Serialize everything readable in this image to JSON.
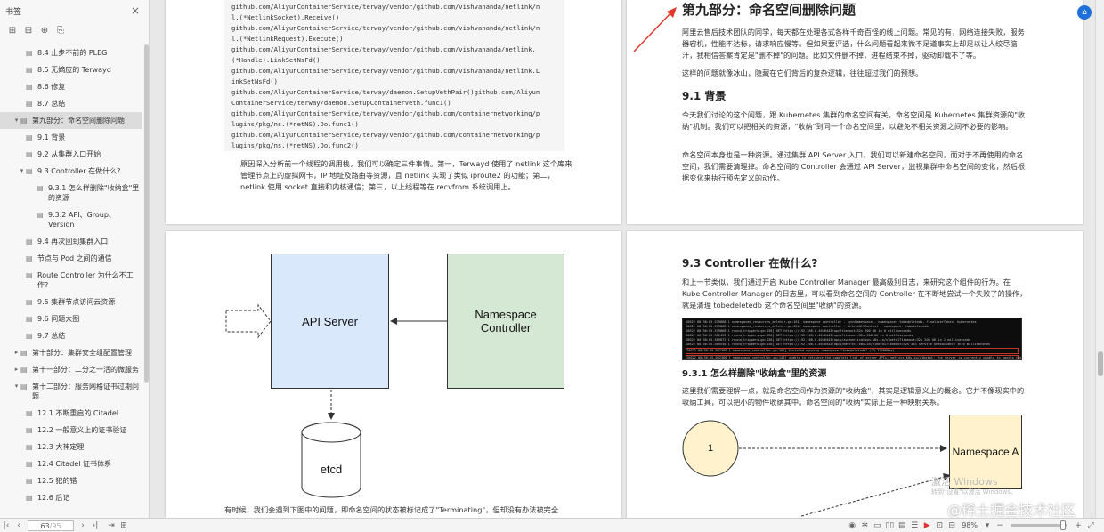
{
  "sidebar": {
    "title": "书签",
    "close_icon": "×",
    "tools": [
      "expand-all-icon",
      "collapse-all-icon",
      "bookmark-add-icon",
      "bookmark-icon"
    ],
    "items": [
      {
        "label": "8.4 止步不前的 PLEG",
        "level": 2,
        "type": "doc",
        "active": false
      },
      {
        "label": "8.5 无嫡应的 Terwayd",
        "level": 2,
        "type": "doc",
        "active": false
      },
      {
        "label": "8.6 修复",
        "level": 2,
        "type": "doc",
        "active": false
      },
      {
        "label": "8.7 总结",
        "level": 2,
        "type": "doc",
        "active": false
      },
      {
        "label": "第九部分：命名空间删除问题",
        "level": 1,
        "type": "expanded",
        "active": true
      },
      {
        "label": "9.1 背景",
        "level": 2,
        "type": "doc",
        "active": false
      },
      {
        "label": "9.2 从集群入口开始",
        "level": 2,
        "type": "doc",
        "active": false
      },
      {
        "label": "9.3 Controller 在做什么?",
        "level": 2,
        "type": "expanded",
        "active": false
      },
      {
        "label": "9.3.1 怎么样删除\"收纳盒\"里的资源",
        "level": 3,
        "type": "doc",
        "active": false
      },
      {
        "label": "9.3.2 API、Group、Version",
        "level": 3,
        "type": "doc",
        "active": false
      },
      {
        "label": "9.4 再次回到集群入口",
        "level": 2,
        "type": "doc",
        "active": false
      },
      {
        "label": "节点与 Pod 之间的通信",
        "level": 2,
        "type": "doc",
        "active": false
      },
      {
        "label": "Route Controller 为什么不工作?",
        "level": 2,
        "type": "doc",
        "active": false
      },
      {
        "label": "9.5 集群节点访问云资源",
        "level": 2,
        "type": "doc",
        "active": false
      },
      {
        "label": "9.6 问题大图",
        "level": 2,
        "type": "doc",
        "active": false
      },
      {
        "label": "9.7 总结",
        "level": 2,
        "type": "doc",
        "active": false
      },
      {
        "label": "第十部分：集群安全组配置管理",
        "level": 1,
        "type": "collapsed",
        "active": false
      },
      {
        "label": "第十一部分：二分之一活的微服务",
        "level": 1,
        "type": "collapsed",
        "active": false
      },
      {
        "label": "第十二部分：服务网格证书过期问题",
        "level": 1,
        "type": "expanded",
        "active": false
      },
      {
        "label": "12.1 不断重启的 Citadel",
        "level": 2,
        "type": "doc",
        "active": false
      },
      {
        "label": "12.2 一般意义上的证书验证",
        "level": 2,
        "type": "doc",
        "active": false
      },
      {
        "label": "12.3 大神定理",
        "level": 2,
        "type": "doc",
        "active": false
      },
      {
        "label": "12.4 Citadel 证书体系",
        "level": 2,
        "type": "doc",
        "active": false
      },
      {
        "label": "12.5 犯的错",
        "level": 2,
        "type": "doc",
        "active": false
      },
      {
        "label": "12.6 后记",
        "level": 2,
        "type": "doc",
        "active": false
      }
    ]
  },
  "page1": {
    "code_lines": [
      "github.com/AliyunContainerService/terway/vendor/github.com/vishvananda/netlink/n",
      "l.(*NetlinkSocket).Receive()",
      "github.com/AliyunContainerService/terway/vendor/github.com/vishvananda/netlink/n",
      "l.(*NetlinkRequest).Execute()",
      "github.com/AliyunContainerService/terway/vendor/github.com/vishvananda/netlink.",
      "(*Handle).LinkSetNsFd()",
      "github.com/AliyunContainerService/terway/vendor/github.com/vishvananda/netlink.L",
      "inkSetNsFd()",
      "github.com/AliyunContainerService/terway/daemon.SetupVethPair()github.com/Aliyun",
      "ContainerService/terway/daemon.SetupContainerVeth.func1()",
      "github.com/AliyunContainerService/terway/vendor/github.com/containernetworking/p",
      "lugins/pkg/ns.(*netNS).Do.func1()",
      "github.com/AliyunContainerService/terway/vendor/github.com/containernetworking/p",
      "lugins/pkg/ns.(*netNS).Do.func2()"
    ],
    "paragraph": "原因深入分析前一个线程的调用栈，我们可以确定三件事情。第一，Terwayd 使用了 netlink 这个库来管理节点上的虚拟网卡，IP 地址及路由等资源，且 netlink 实现了类似 iproute2 的功能；第二，netlink 使用 socket 直接和内核通信；第三，以上线程等在 recvfrom 系统调用上。"
  },
  "page2": {
    "title": "第九部分：命名空间删除问题",
    "intro1": "阿里云售后技术团队的同学，每天都在处理各式各样千奇百怪的线上问题。常见的有，网络连接失败，服务器宕机，性能不达标，请求响应慢等。但如果要评选，什么问题看起来微不足道事实上却足以让人绞尽脑汁，我相信答案肯定是\"删不掉\"的问题。比如文件删不掉，进程结束不掉，驱动卸载不了等。",
    "intro2": "这样的问题就像冰山，隐藏在它们背后的复杂逻辑，往往超过我们的预想。",
    "h91": "9.1 背景",
    "p91a": "今天我们讨论的这个问题，跟 Kubernetes 集群的命名空间有关。命名空间是 Kubernetes 集群资源的\"收纳\"机制。我们可以把相关的资源，\"收纳\"到同一个命名空间里，以避免不相关资源之间不必要的影响。",
    "p91b": "命名空间本身也是一种资源。通过集群 API Server 入口，我们可以新建命名空间，而对于不再使用的命名空间，我们需要清理掉。命名空间的 Controller 会通过 API Server，监视集群中命名空间的变化，然后根据变化来执行预先定义的动作。"
  },
  "page3": {
    "api_server": "API Server",
    "ns_controller": "Namespace Controller",
    "etcd": "etcd",
    "bottom_text": "有时候，我们会遇到下图中的问题，即命名空间的状态被标记成了\"Terminating\"，但却没有办法被完全"
  },
  "page4": {
    "h93": "9.3 Controller 在做什么?",
    "p93": "和上一节类似，我们通过开启 Kube Controller Manager 最高级别日志，来研究这个组件的行为。在 Kube Controller Manager 的日志里，可以看到命名空间的 Controller 在不断地尝试一个失败了的操作，就是清理 tobedeletedb 这个命名空间里\"收纳\"的资源。",
    "h931": "9.3.1 怎么样删除\"收纳盒\"里的资源",
    "p931": "这里我们需要理解一点，就是命名空间作为资源的\"收纳盒\"，其实是逻辑意义上的概念。它并不像现实中的收纳工具，可以把小的物件收纳其中。命名空间的\"收纳\"实际上是一种映射关系。",
    "circle_label": "1",
    "ns_a": "Namespace A",
    "terminal_lines": [
      "I0622 00:36:05.579868   1 namespaced_resources_deleter.go:161] namespace controller - syncNamespace - namespace: tobedeletedb, finalizerToken: kubernetes",
      "I0622 00:36:05.579868   1 namespaced_resources_deleter.go:424] namespace controller - deleteAllContent - namespace: tobedeletedb",
      "I0622 00:36:05.579868   1 round_trippers.go:438] GET https://192.168.0.40:6443/api?timeout=32s 200 OK in 0 milliseconds",
      "I0622 00:36:05.582453   1 round_trippers.go:438] GET https://192.168.0.40:6443/apis?timeout=32s 200 OK in 0 milliseconds",
      "I0622 00:36:05.589872   1 round_trippers.go:438] GET https://192.168.0.40:6443/apis/authentication.k8s.io/v1beta1?timeout=32s 200 OK in 1 milliseconds",
      "I0622 00:36:05.589530   1 round_trippers.go:438] GET https://192.168.0.40:6443/apis/metrics.k8s.io/v1beta1?timeout=32s 503 Service Unavailable in 0 milliseconds",
      "I0622 00:36:05.602360   1 namespace_controller.go:161] finished syncing namespace \"tobedeletedb\" (22.220889ms)",
      "I0622 00:36:05.602360   1 namespace_controller.go:148] unable to retrieve the complete list of server APIs: metrics.k8s.io/v1beta1: the server is currently unable to handle the request"
    ],
    "watermark1": "激活 Windows",
    "watermark1b": "转到\"设置\"以激活 Windows。",
    "watermark2": "@稀土掘金技术社区"
  },
  "statusbar": {
    "page_current": "63",
    "page_total": "/95",
    "zoom": "98%"
  },
  "colors": {
    "api_server_fill": "#dae8fc",
    "ns_controller_fill": "#d5e8d4",
    "circle_fill": "#fff2cc",
    "ns_a_fill": "#fff2cc",
    "arrow_red": "#e03a2f",
    "app_blue": "#1e6fd9"
  }
}
